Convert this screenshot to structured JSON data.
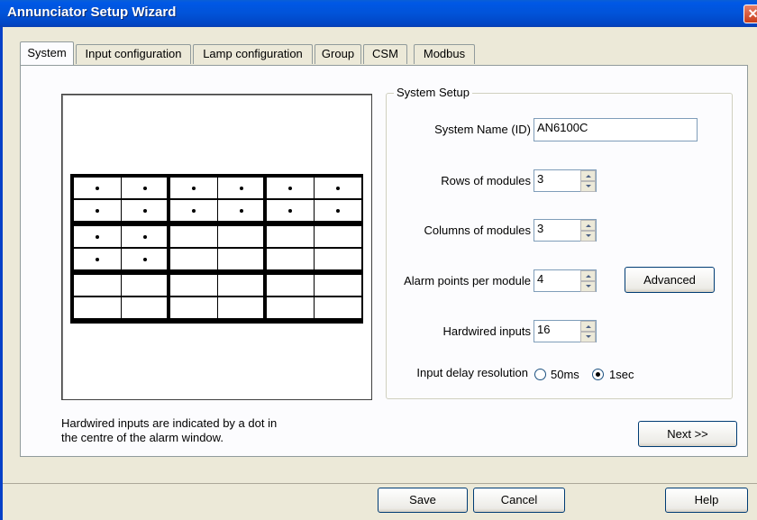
{
  "window": {
    "title": "Annunciator Setup Wizard",
    "close_glyph": "✕"
  },
  "tabs": [
    {
      "label": "System",
      "active": true
    },
    {
      "label": "Input configuration"
    },
    {
      "label": "Lamp configuration"
    },
    {
      "label": "Group"
    },
    {
      "label": "CSM"
    },
    {
      "label": "Modbus"
    }
  ],
  "system_setup": {
    "group_label": "System Setup",
    "system_name_label": "System Name (ID)",
    "system_name_value": "AN6100C",
    "rows_label": "Rows of modules",
    "rows_value": "3",
    "columns_label": "Columns of modules",
    "columns_value": "3",
    "alarm_points_label": "Alarm points per module",
    "alarm_points_value": "4",
    "advanced_label": "Advanced",
    "hardwired_label": "Hardwired inputs",
    "hardwired_value": "16",
    "delay_label": "Input delay resolution",
    "delay_options": [
      "50ms",
      "1sec"
    ],
    "delay_selected": "1sec"
  },
  "preview": {
    "rows": 3,
    "columns": 3,
    "alarm_points": 4,
    "hardwired_inputs": 16,
    "unused_color": "#aba496"
  },
  "note": {
    "line1": "Hardwired inputs are indicated by a dot in",
    "line2": "the centre of the alarm window."
  },
  "buttons": {
    "next": "Next >>",
    "save": "Save",
    "cancel": "Cancel",
    "help": "Help"
  }
}
